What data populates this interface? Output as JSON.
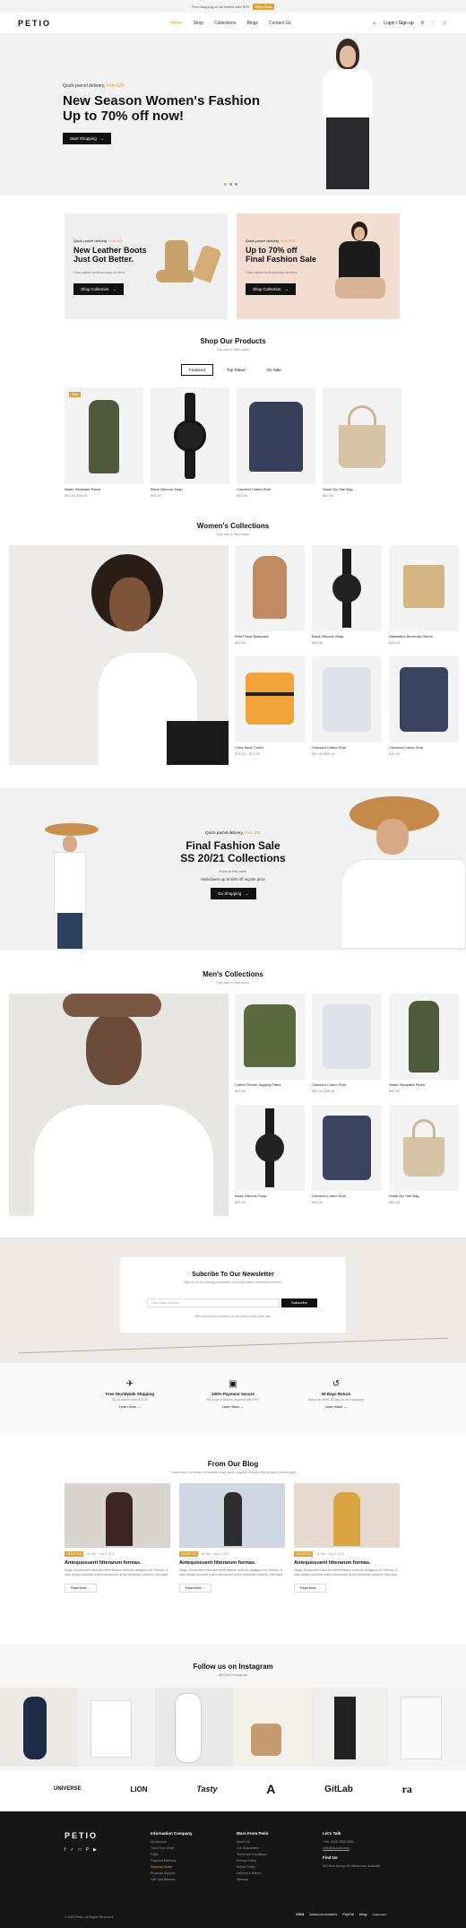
{
  "topbar": {
    "text": "Free shipping on all orders over $75",
    "cta": "Shop Now"
  },
  "nav": {
    "logo": "PETIO",
    "links": [
      "Home",
      "Shop",
      "Collections",
      "Blogs",
      "Contact Us"
    ],
    "login": "Login / Sign up"
  },
  "hero": {
    "kicker": "Quick parcel delivery,",
    "kicker_accent": "from $25",
    "title_1": "New Season Women's Fashion",
    "title_2": "Up to 70% off now!",
    "button": "Start Shopping"
  },
  "promos": [
    {
      "kicker": "Quick parcel delivery,",
      "accent": "from $25",
      "title_1": "New Leather Boots",
      "title_2": "Just Got Better.",
      "desc": "Class aptent taciti sociosqu ad litora",
      "button": "Shop Collection"
    },
    {
      "kicker": "Quick parcel delivery,",
      "accent": "from $25",
      "title_1": "Up to 70% off",
      "title_2": "Final Fashion Sale",
      "desc": "Class aptent taciti sociosqu ad litora",
      "button": "Shop Collection"
    }
  ],
  "shop": {
    "title": "Shop Our Products",
    "subtitle": "Top sale in this week",
    "tabs": [
      "Featured",
      "Top Rated",
      "On Sale"
    ],
    "products": [
      {
        "name": "Water-Resistant Parka",
        "price": "$60.00 $45.00",
        "badge": "Sale"
      },
      {
        "name": "Black Silicone Strap",
        "price": "$60.00",
        "badge": ""
      },
      {
        "name": "Checked Cotton Shirt",
        "price": "$60.00",
        "badge": ""
      },
      {
        "name": "Small Zip Tote Bag",
        "price": "$60.00",
        "badge": ""
      }
    ]
  },
  "women": {
    "title": "Women's Collections",
    "subtitle": "Top sale in this week",
    "products": [
      {
        "name": "Petit Pique Backpack",
        "price": "$30.00"
      },
      {
        "name": "Black Silicone Strap",
        "price": "$60.00"
      },
      {
        "name": "Gabardine Bermuda Shorts",
        "price": "$30.00"
      },
      {
        "name": "Crew Neck T-shirt",
        "price": "$15.00 - $27.00"
      },
      {
        "name": "Checked Cotton Shirt",
        "price": "$60.00 $50.00"
      },
      {
        "name": "Checked Cotton Shirt",
        "price": "$30.00"
      }
    ]
  },
  "banner": {
    "kicker": "Quick parcel delivery,",
    "accent": "from $25",
    "title_1": "Final Fashion Sale",
    "title_2": "SS 20/21 Collections",
    "small": "Final on this week",
    "desc": "Markdowns up to 50% off regular price",
    "button": "Go Shopping"
  },
  "men": {
    "title": "Men's Collections",
    "subtitle": "Top sale in this week",
    "products": [
      {
        "name": "Cotton Fleece Jogging Pants",
        "price": "$30.00"
      },
      {
        "name": "Checked Cotton Shirt",
        "price": "$60.00 $50.00"
      },
      {
        "name": "Water-Resistant Parka",
        "price": "$60.00"
      },
      {
        "name": "Black Silicone Strap",
        "price": "$60.00"
      },
      {
        "name": "Checked Cotton Shirt",
        "price": "$60.00"
      },
      {
        "name": "Small Zip Tote Bag",
        "price": "$60.00"
      }
    ]
  },
  "newsletter": {
    "title": "Subcribe To Our Newsletter",
    "subtitle": "Sign up for the weekly newsletter and build better ecommerce stores.",
    "placeholder": "Your email address",
    "button": "Subscribe",
    "note": "We respect your privacy, so we never share your info."
  },
  "features": [
    {
      "title": "Free Worldwide Shipping",
      "desc": "On all orders over $75.00",
      "link": "Learn More"
    },
    {
      "title": "100% Payment Secure",
      "desc": "We ensure secure payment with PEV",
      "link": "Learn More"
    },
    {
      "title": "30 Days Return",
      "desc": "Return it within 30 day for an exchange",
      "link": "Learn More"
    }
  ],
  "blog": {
    "title": "From Our Blog",
    "subtitle": "Commodo sociosqu venenatis cras dolor sagittis integer luctus sem primis eget",
    "posts": [
      {
        "tag": "LIFESTYLE",
        "meta": "Mr Vels · May 5, 2023",
        "title": "Antequosuerit litterarum formas.",
        "desc": "Dega, Kolma and Toira are three kitchen utensils designed for Ohrimo, a new design oriented brand introduced at the Ambiente show in February.",
        "button": "Read More"
      },
      {
        "tag": "LIFESTYLE",
        "meta": "Mr Vels · May 5, 2023",
        "title": "Antequosuerit litterarum formas.",
        "desc": "Dega, Kolma and Toira are three kitchen utensils designed for Ohrimo, a new design oriented brand introduced at the Ambiente show in February.",
        "button": "Read More"
      },
      {
        "tag": "LIFESTYLE",
        "meta": "Mr Vels · May 5, 2023",
        "title": "Antequosuerit litterarum formas.",
        "desc": "Dega, Kolma and Toira are three kitchen utensils designed for Ohrimo, a new design oriented brand introduced at the Ambiente show in February.",
        "button": "Read More"
      }
    ]
  },
  "instagram": {
    "title": "Follow us on Instagram",
    "subtitle": "@Petio Instagram"
  },
  "brands": [
    "UNIVERSE",
    "LION",
    "Tasty",
    "A",
    "GitLab",
    "ra"
  ],
  "footer": {
    "logo": "PETIO",
    "col1": {
      "title": "Information Company",
      "items": [
        "My Account",
        "Track Your Order",
        "FAQs",
        "Payment Methods",
        "Shipping Guide",
        "Products Support",
        "Gift Card Balance"
      ]
    },
    "col2": {
      "title": "More From Petio",
      "items": [
        "About Us",
        "Our Guarantees",
        "Terms and Conditions",
        "Privacy Policy",
        "Return Policy",
        "Delivery & Return",
        "Sitemap"
      ]
    },
    "col3": {
      "title": "Let's Talk",
      "phone": "+391 (0)35 2568 4593",
      "email": "hello@domain.com",
      "find": "Find Us",
      "address": "502 New Design Str Melbourne, Australia"
    },
    "copyright": "© 2023 Petio. All Rights Reserved",
    "payments": [
      "VISA",
      "AMERICAN EXPRESS",
      "PayPal",
      "ebay",
      "mastercard"
    ]
  }
}
